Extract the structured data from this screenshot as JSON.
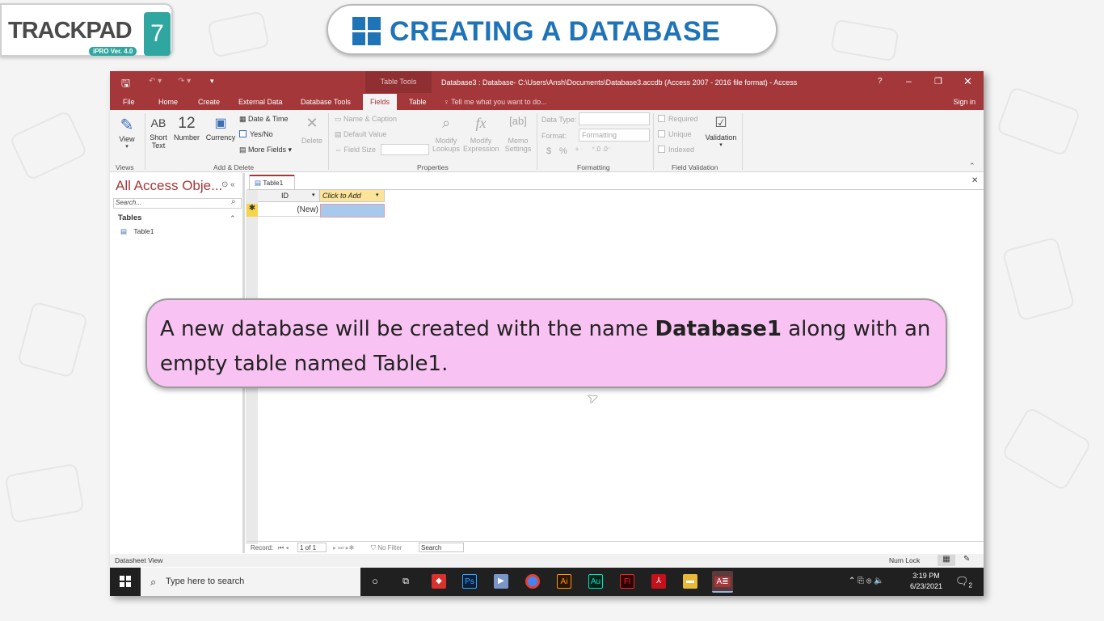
{
  "logo": {
    "word": "TRACKPAD",
    "number": "7",
    "version": "iPRO Ver. 4.0"
  },
  "banner": {
    "title": "CREATING A DATABASE"
  },
  "access": {
    "titlebar": {
      "context_tab": "Table Tools",
      "window_title": "Database3 : Database- C:\\Users\\Ansh\\Documents\\Database3.accdb (Access 2007 - 2016 file format) - Access",
      "help": "?",
      "minimize": "–",
      "restore": "❐",
      "close": "✕"
    },
    "tabs": [
      "File",
      "Home",
      "Create",
      "External Data",
      "Database Tools",
      "Fields",
      "Table"
    ],
    "active_tab": "Fields",
    "tell_me": "Tell me what you want to do...",
    "sign_in": "Sign in",
    "ribbon": {
      "view": "View",
      "short_text_icon": "AB",
      "short_text_l1": "Short",
      "short_text_l2": "Text",
      "number_icon": "12",
      "number": "Number",
      "currency": "Currency",
      "date_time": "Date & Time",
      "yes_no": "Yes/No",
      "more_fields": "More Fields",
      "delete": "Delete",
      "name_caption": "Name & Caption",
      "default_value": "Default Value",
      "field_size": "Field Size",
      "modify_lookups_l1": "Modify",
      "modify_lookups_l2": "Lookups",
      "modify_expression_l1": "Modify",
      "modify_expression_l2": "Expression",
      "memo_settings_l1": "Memo",
      "memo_settings_l2": "Settings",
      "data_type": "Data Type:",
      "format": "Format:",
      "format_value": "Formatting",
      "currency_sym": "$",
      "percent_sym": "%",
      "comma_sym": "⁹",
      "required": "Required",
      "unique": "Unique",
      "indexed": "Indexed",
      "validation": "Validation",
      "groups": [
        "Views",
        "Add & Delete",
        "Properties",
        "Formatting",
        "Field Validation"
      ]
    },
    "nav": {
      "header": "All Access Obje...",
      "search_placeholder": "Search...",
      "section": "Tables",
      "items": [
        "Table1"
      ]
    },
    "doc": {
      "tab": "Table1",
      "col_id": "ID",
      "col_add": "Click to Add",
      "new_row_marker": "✱",
      "new_row_value": "(New)"
    },
    "record_nav": {
      "label": "Record:",
      "position": "1 of 1",
      "filter": "No Filter",
      "search": "Search"
    },
    "status": {
      "left": "Datasheet View",
      "numlock": "Num Lock"
    },
    "taskbar": {
      "search": "Type here to search",
      "time": "3:19 PM",
      "date": "6/23/2021",
      "notifications": "2",
      "apps": [
        "Ps",
        "Ai",
        "Au",
        "Fl",
        "A≣"
      ]
    }
  },
  "callout": {
    "before": "A new database will be created with the name ",
    "bold": "Database1",
    "after": " along with an empty table named Table1."
  }
}
